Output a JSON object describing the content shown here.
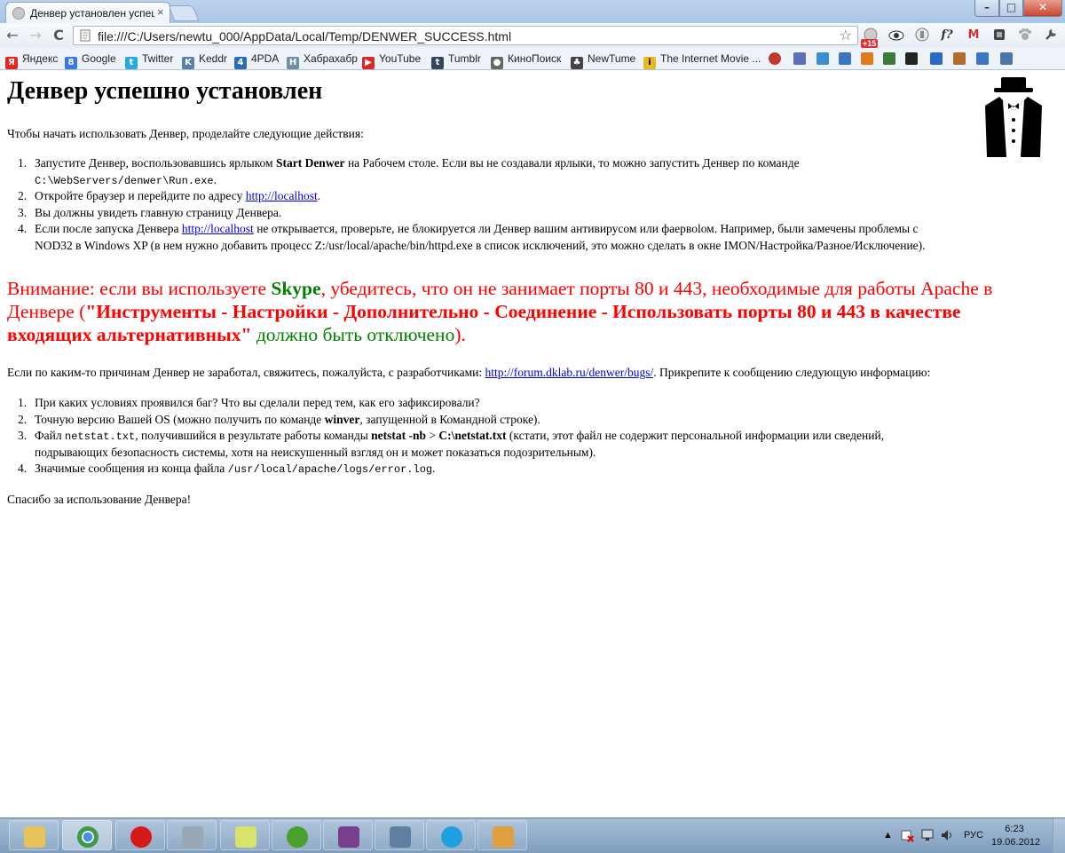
{
  "window": {
    "tab_title": "Денвер установлен успеш",
    "tab_close": "×",
    "min_label": "–",
    "max_label": "□",
    "close_label": "✕"
  },
  "toolbar": {
    "back": "←",
    "forward": "→",
    "reload": "C",
    "url": "file:///C:/Users/newtu_000/AppData/Local/Temp/DENWER_SUCCESS.html",
    "star": "☆",
    "ext_badge": "+15",
    "ext_f": "f?",
    "ext_gmail": "M",
    "menu": "☰"
  },
  "bookmarks": [
    {
      "label": "Яндекс",
      "color": "#e52620",
      "glyph": "Я"
    },
    {
      "label": "Google",
      "color": "#3b78e7",
      "glyph": "8"
    },
    {
      "label": "Twitter",
      "color": "#2aa9e0",
      "glyph": "t"
    },
    {
      "label": "Keddr",
      "color": "#5a7fa8",
      "glyph": "K"
    },
    {
      "label": "4PDA",
      "color": "#2a6db5",
      "glyph": "4"
    },
    {
      "label": "Хабрахабр",
      "color": "#6f8ea8",
      "glyph": "H"
    },
    {
      "label": "YouTube",
      "color": "#d62b2b",
      "glyph": "▶"
    },
    {
      "label": "Tumblr",
      "color": "#35465c",
      "glyph": "t"
    },
    {
      "label": "КиноПоиск",
      "color": "#666666",
      "glyph": "●"
    },
    {
      "label": "NewTume",
      "color": "#444444",
      "glyph": "♣"
    },
    {
      "label": "The Internet Movie ...",
      "color": "#e6b91e",
      "glyph": "i"
    }
  ],
  "page": {
    "title": "Денвер успешно установлен",
    "intro": "Чтобы начать использовать Денвер, проделайте следующие действия:",
    "steps": {
      "s1_a": "Запустите Денвер, воспользовавшись ярлыком ",
      "s1_b": "Start Denwer",
      "s1_c": " на Рабочем столе. Если вы не создавали ярлыки, то можно запустить Денвер по команде",
      "s1_code": "C:\\WebServers/denwer\\Run.exe",
      "s1_d": ".",
      "s2_a": "Откройте браузер и перейдите по адресу ",
      "s2_link": "http://localhost",
      "s2_b": ".",
      "s3": "Вы должны увидеть главную страницу Денвера.",
      "s4_a": "Если после запуска Денвера ",
      "s4_link": "http://localhost",
      "s4_b": " не открывается, проверьте, не блокируется ли Денвер вашим антивирусом или фаервolом. Например, были замечены проблемы с",
      "s4_c": "NOD32 в Windows XP (в нем нужно добавить процесс Z:/usr/local/apache/bin/httpd.exe в список исключений, это можно сделать в окне IMON/Настройка/Разное/Исключение)."
    },
    "warning": {
      "w1": "Внимание: если вы используете ",
      "skype": "Skype",
      "w2": ", убедитесь, что он не занимает порты 80 и 443, необходимые для работы Apache в Денвере (",
      "bold": "\"Инструменты - Настройки - Дополнительно - Соединение - Использовать порты 80 и 443 в качестве входящих альтернативных\"",
      "green": " должно быть отключено",
      "w3": ")."
    },
    "help": {
      "h_a": "Если по каким-то причинам Денвер не заработал, свяжитесь, пожалуйста, с разработчиками: ",
      "h_link": "http://forum.dklab.ru/denwer/bugs/",
      "h_b": ". Прикрепите к сообщению следующую информацию:"
    },
    "report": {
      "r1": "При каких условиях проявился баг? Что вы сделали перед тем, как его зафиксировали?",
      "r2_a": "Точную версию Вашей OS (можно получить по команде ",
      "r2_b": "winver",
      "r2_c": ", запущенной в Командной строке).",
      "r3_a": "Файл ",
      "r3_code": "netstat.txt",
      "r3_b": ", получившийся в результате работы команды ",
      "r3_cmd": "netstat -nb",
      "r3_gt": " > ",
      "r3_file": "C:\\netstat.txt",
      "r3_c": " (кстати, этот файл не содержит персональной информации или сведений,",
      "r3_d": "подрывающих безопасность системы, хотя на неискушенный взгляд он и может показаться подозрительным).",
      "r4_a": "Значимые сообщения из конца файла ",
      "r4_code": "/usr/local/apache/logs/error.log",
      "r4_b": "."
    },
    "thanks": "Спасибо за использование Денвера!"
  },
  "numbers": [
    "1.",
    "2.",
    "3.",
    "4."
  ],
  "taskbar": {
    "apps": [
      {
        "name": "explorer",
        "color": "#e8c25a"
      },
      {
        "name": "chrome",
        "color": "#3c9a4a"
      },
      {
        "name": "opera",
        "color": "#d61a1a"
      },
      {
        "name": "calculator",
        "color": "#9aa7b4"
      },
      {
        "name": "sticky-notes",
        "color": "#d9e36a"
      },
      {
        "name": "utorrent",
        "color": "#4aa02c"
      },
      {
        "name": "winrar",
        "color": "#7a3f8c"
      },
      {
        "name": "system-tool",
        "color": "#5f7ea0"
      },
      {
        "name": "skype",
        "color": "#1ea1e1"
      },
      {
        "name": "paint",
        "color": "#e0a040"
      }
    ],
    "tray_arrow": "▲",
    "language": "РУС",
    "time": "6:23",
    "date": "19.06.2012"
  }
}
